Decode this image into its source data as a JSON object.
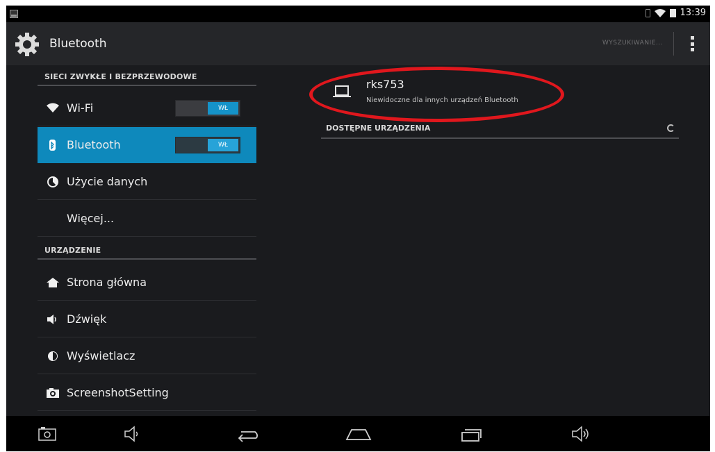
{
  "status_bar": {
    "time": "13:39"
  },
  "action_bar": {
    "title": "Bluetooth",
    "search_action": "WYSZUKIWANIE...",
    "icon": "settings-gear-icon",
    "overflow_icon": "overflow-menu-icon"
  },
  "sidebar": {
    "sections": [
      {
        "header": "SIECI ZWYKŁE I BEZPRZEWODOWE"
      },
      {
        "header": "URZĄDZENIE"
      }
    ],
    "items": [
      {
        "label": "Wi-Fi",
        "icon": "wifi-icon",
        "toggle": "WŁ"
      },
      {
        "label": "Bluetooth",
        "icon": "bluetooth-icon",
        "toggle": "WŁ",
        "active": true
      },
      {
        "label": "Użycie danych",
        "icon": "data-usage-icon"
      },
      {
        "label": "Więcej...",
        "icon": ""
      },
      {
        "label": "Strona główna",
        "icon": "home-icon"
      },
      {
        "label": "Dźwięk",
        "icon": "sound-icon"
      },
      {
        "label": "Wyświetlacz",
        "icon": "display-icon"
      },
      {
        "label": "ScreenshotSetting",
        "icon": "camera-icon"
      }
    ]
  },
  "main": {
    "device": {
      "name": "rks753",
      "subtitle": "Niewidoczne dla innych urządzeń Bluetooth",
      "icon": "laptop-icon"
    },
    "available_header": "DOSTĘPNE URZĄDZENIA"
  },
  "navbar": {
    "buttons": [
      "screenshot-icon",
      "volume-down-icon",
      "back-icon",
      "home-icon",
      "recents-icon",
      "volume-up-icon"
    ]
  },
  "colors": {
    "accent": "#0e89bc",
    "toggle_on": "#1593c9",
    "highlight_ellipse": "#e0171d",
    "background": "#1a1b1e"
  }
}
